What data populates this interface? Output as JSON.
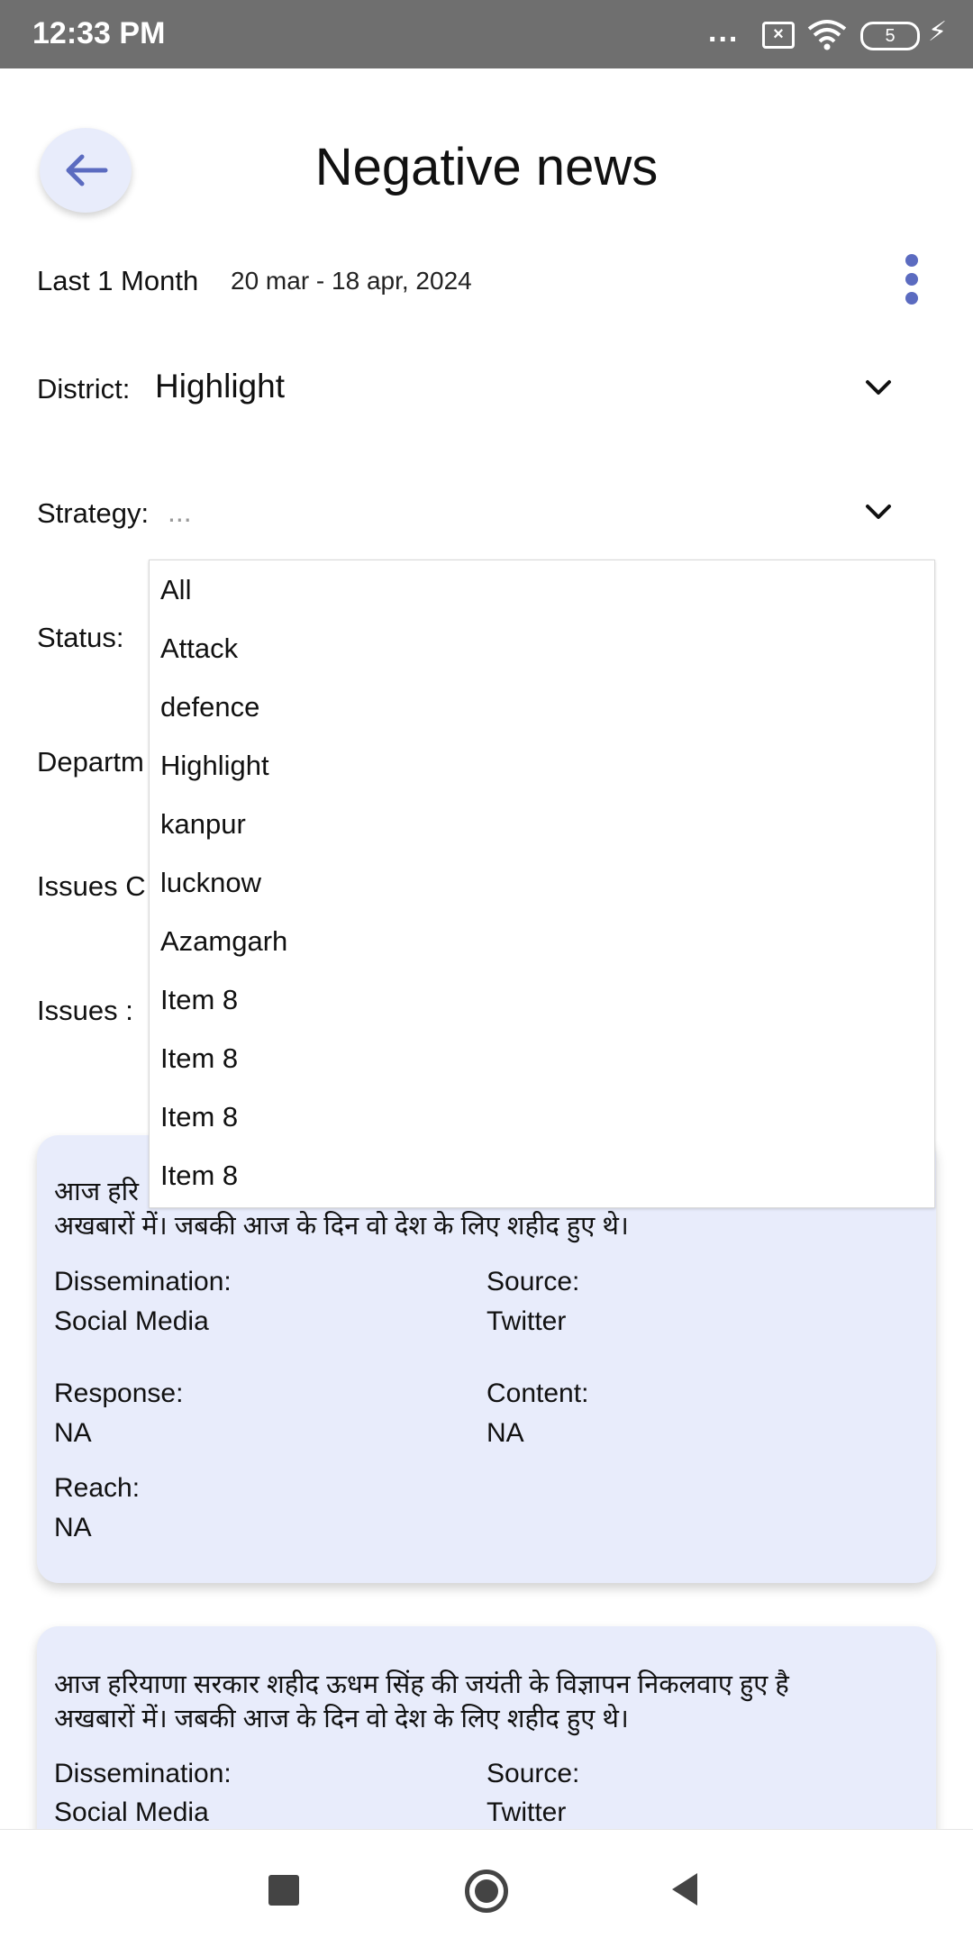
{
  "status_bar": {
    "time": "12:33 PM",
    "dots": "...",
    "battery": "5",
    "icons": [
      "sim-x-icon",
      "wifi-icon",
      "battery-icon",
      "charging-bolt-icon"
    ]
  },
  "header": {
    "title": "Negative news",
    "back_icon": "arrow-left-icon"
  },
  "date_range": {
    "label": "Last 1 Month",
    "dates": "20 mar - 18 apr, 2024"
  },
  "filters": {
    "district_label": "District:",
    "district_value": "Highlight",
    "strategy_label": "Strategy:",
    "strategy_placeholder": "...",
    "status_label": "Status:",
    "department_label": "Departm",
    "issues_category_label": "Issues C",
    "issues_label": "Issues :"
  },
  "dropdown": {
    "options": [
      "All",
      "Attack",
      "defence",
      "Highlight",
      "kanpur",
      "lucknow",
      "Azamgarh",
      "Item 8",
      "Item 8",
      "Item 8",
      "Item 8"
    ]
  },
  "cards": [
    {
      "text_line1_visible": "आज हरि",
      "text_line2": "अखबारों में। जबकी आज के दिन वो देश के लिए शहीद हुए थे।",
      "dissemination_label": "Dissemination:",
      "dissemination_value": "Social Media",
      "source_label": "Source:",
      "source_value": "Twitter",
      "response_label": "Response:",
      "response_value": "NA",
      "content_label": "Content:",
      "content_value": "NA",
      "reach_label": "Reach:",
      "reach_value": "NA"
    },
    {
      "text_line1": "आज हरियाणा सरकार शहीद ऊधम सिंह की जयंती के विज्ञापन निकलवाए हुए है",
      "text_line2": "अखबारों में। जबकी आज के दिन वो देश के लिए शहीद हुए थे।",
      "dissemination_label": "Dissemination:",
      "dissemination_value": "Social Media",
      "source_label": "Source:",
      "source_value": "Twitter"
    }
  ],
  "accent_color": "#5b6bc0",
  "card_color": "#e8ecfb"
}
